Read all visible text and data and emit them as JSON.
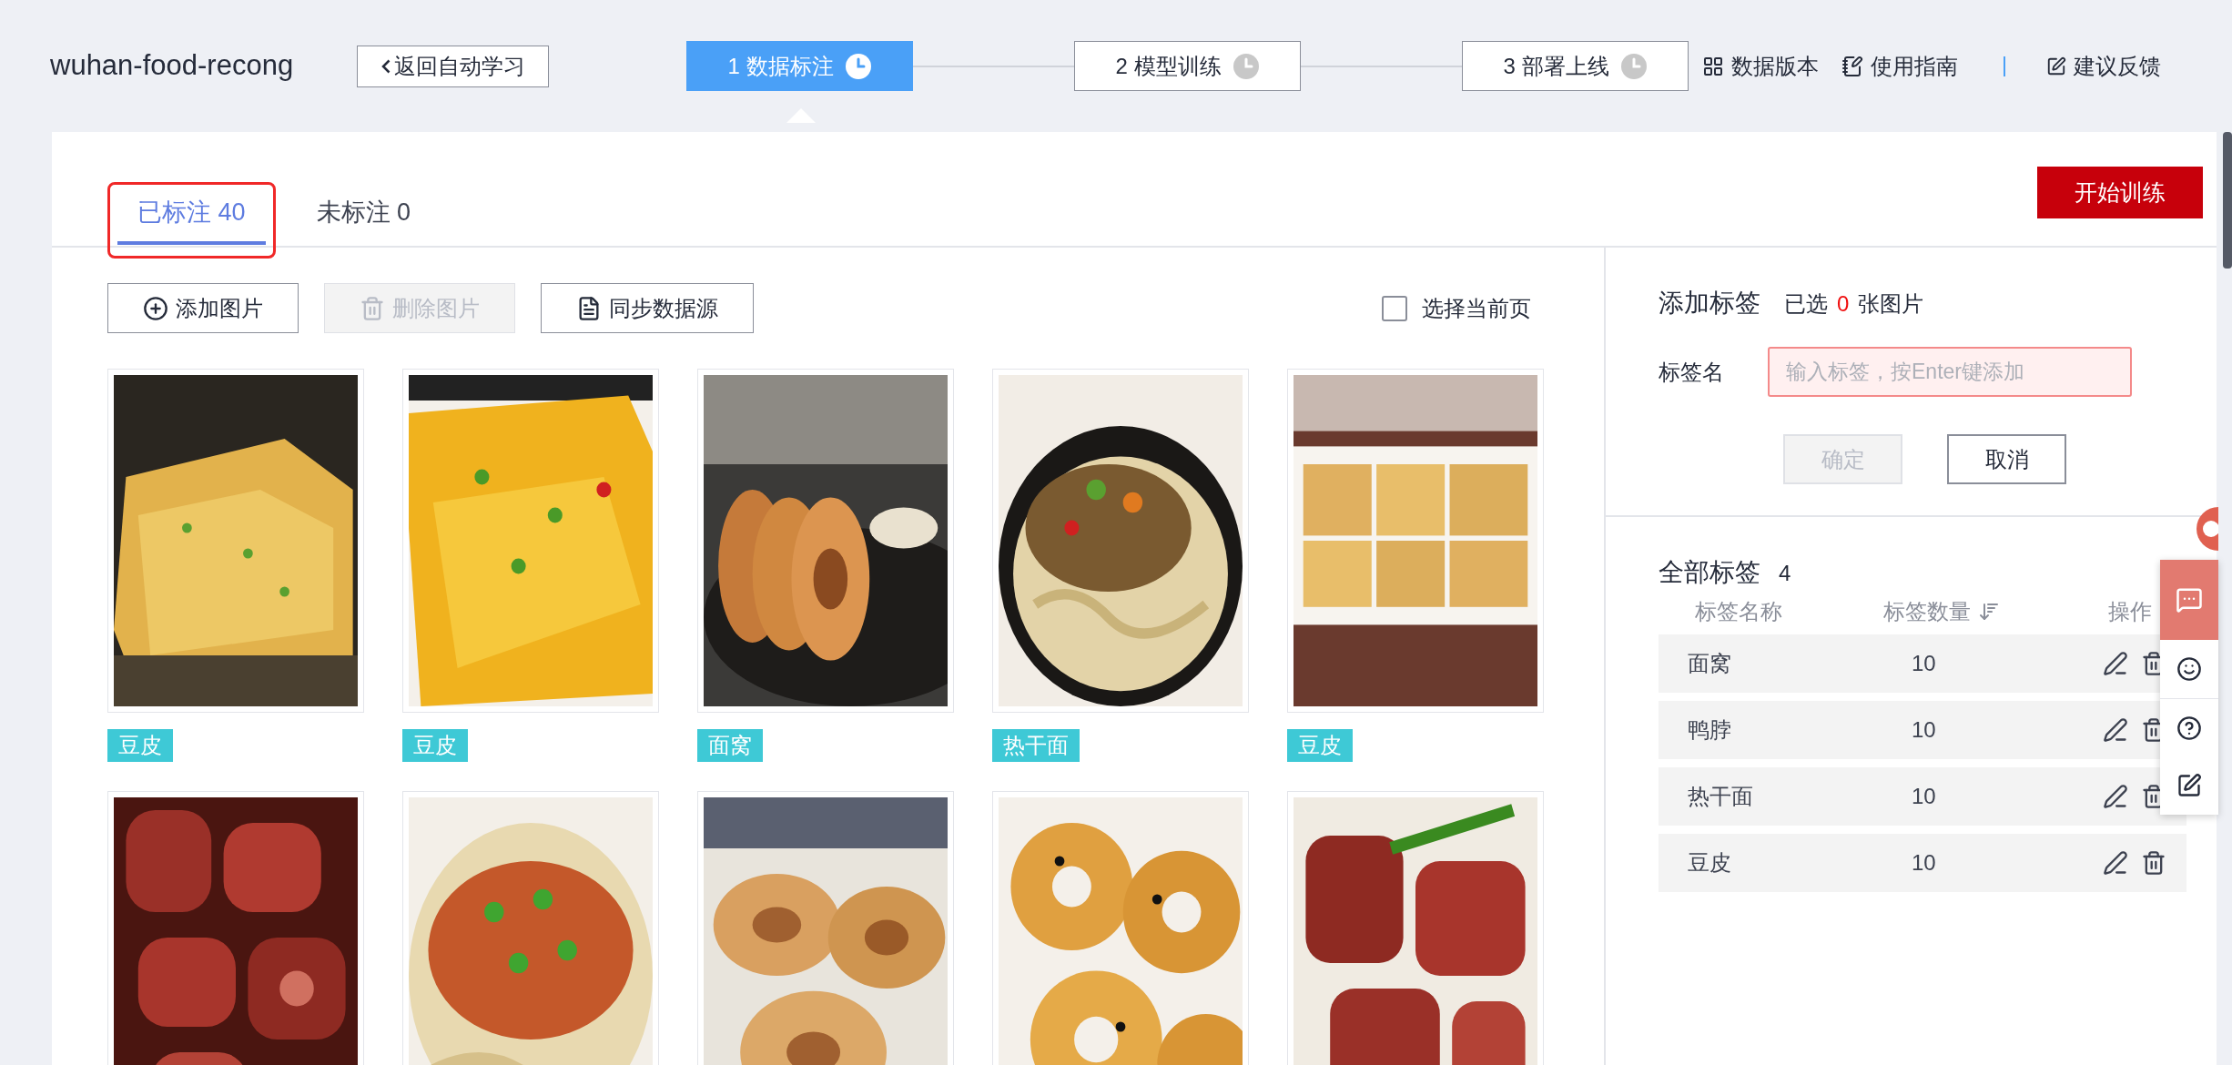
{
  "project": "wuhan-food-recong",
  "back_button": "返回自动学习",
  "steps": [
    {
      "label": "1 数据标注",
      "selected": true
    },
    {
      "label": "2 模型训练",
      "selected": false
    },
    {
      "label": "3 部署上线",
      "selected": false
    }
  ],
  "links": [
    "数据版本",
    "使用指南",
    "建议反馈"
  ],
  "tabs": [
    {
      "label": "已标注 40",
      "selected": true,
      "highlighted": true
    },
    {
      "label": "未标注 0",
      "selected": false,
      "highlighted": false
    }
  ],
  "train_button": "开始训练",
  "toolbar": [
    {
      "label": "添加图片",
      "disabled": false
    },
    {
      "label": "删除图片",
      "disabled": true
    },
    {
      "label": "同步数据源",
      "disabled": false
    }
  ],
  "select_page": {
    "label": "选择当前页",
    "checked": false
  },
  "images": [
    {
      "kind": "picture",
      "tag": "豆皮"
    },
    {
      "kind": "picture",
      "tag": "豆皮"
    },
    {
      "kind": "picture",
      "tag": "面窝"
    },
    {
      "kind": "picture",
      "tag": "热干面"
    },
    {
      "kind": "picture",
      "tag": "豆皮"
    },
    {
      "kind": "picture"
    },
    {
      "kind": "picture"
    },
    {
      "kind": "picture"
    },
    {
      "kind": "picture"
    },
    {
      "kind": "picture"
    }
  ],
  "add_tag": {
    "title": "添加标签",
    "selected_prefix": "已选",
    "selected_count": "0",
    "selected_suffix": "张图片",
    "field_label": "标签名",
    "placeholder": "输入标签，按Enter键添加",
    "invalid": true,
    "confirm": {
      "label": "确定",
      "disabled": true
    },
    "cancel": "取消"
  },
  "all_tags": {
    "title": "全部标签",
    "count": "4",
    "columns": [
      "标签名称",
      "标签数量",
      "操作"
    ],
    "rows": [
      {
        "name": "面窝",
        "count": "10"
      },
      {
        "name": "鸭脖",
        "count": "10"
      },
      {
        "name": "热干面",
        "count": "10"
      },
      {
        "name": "豆皮",
        "count": "10"
      }
    ]
  }
}
